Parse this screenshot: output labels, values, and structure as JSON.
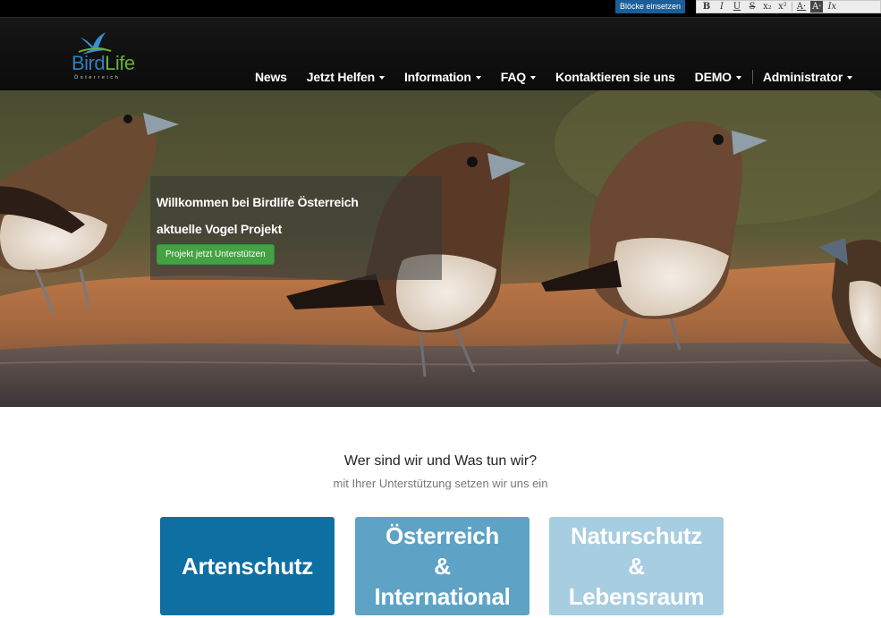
{
  "editor_toolbar": {
    "blocks_label": "Blöcke einsetzen",
    "format_buttons": [
      "B",
      "I",
      "U",
      "S",
      "x₂",
      "x²",
      "A·",
      "A·",
      "Ix"
    ]
  },
  "brand": {
    "name_part1": "Bird",
    "name_part2": "Life",
    "subtitle": "Österreich",
    "colors": {
      "blue": "#2f7fc0",
      "green": "#6aae3e"
    }
  },
  "nav": {
    "items": [
      {
        "label": "News",
        "has_dropdown": false
      },
      {
        "label": "Jetzt Helfen",
        "has_dropdown": true
      },
      {
        "label": "Information",
        "has_dropdown": true
      },
      {
        "label": "FAQ",
        "has_dropdown": true
      },
      {
        "label": "Kontaktieren sie uns",
        "has_dropdown": false
      },
      {
        "label": "DEMO",
        "has_dropdown": true
      }
    ],
    "admin": {
      "label": "Administrator",
      "has_dropdown": true
    }
  },
  "hero": {
    "title": "Willkommen bei Birdlife Österreich",
    "subtitle": "aktuelle Vogel Projekt",
    "button_label": "Projekt jetzt Unterstützen",
    "button_color": "#45a244"
  },
  "intro": {
    "title": "Wer sind wir und Was tun wir?",
    "subtitle": "mit Ihrer Unterstützung setzen wir uns ein"
  },
  "tiles": [
    {
      "lines": [
        "Artenschutz"
      ],
      "color": "#0e6fa3"
    },
    {
      "lines": [
        "Österreich",
        "&",
        "International"
      ],
      "color": "#5ea3c5"
    },
    {
      "lines": [
        "Naturschutz",
        "&",
        "Lebensraum"
      ],
      "color": "#a6cde0"
    }
  ]
}
